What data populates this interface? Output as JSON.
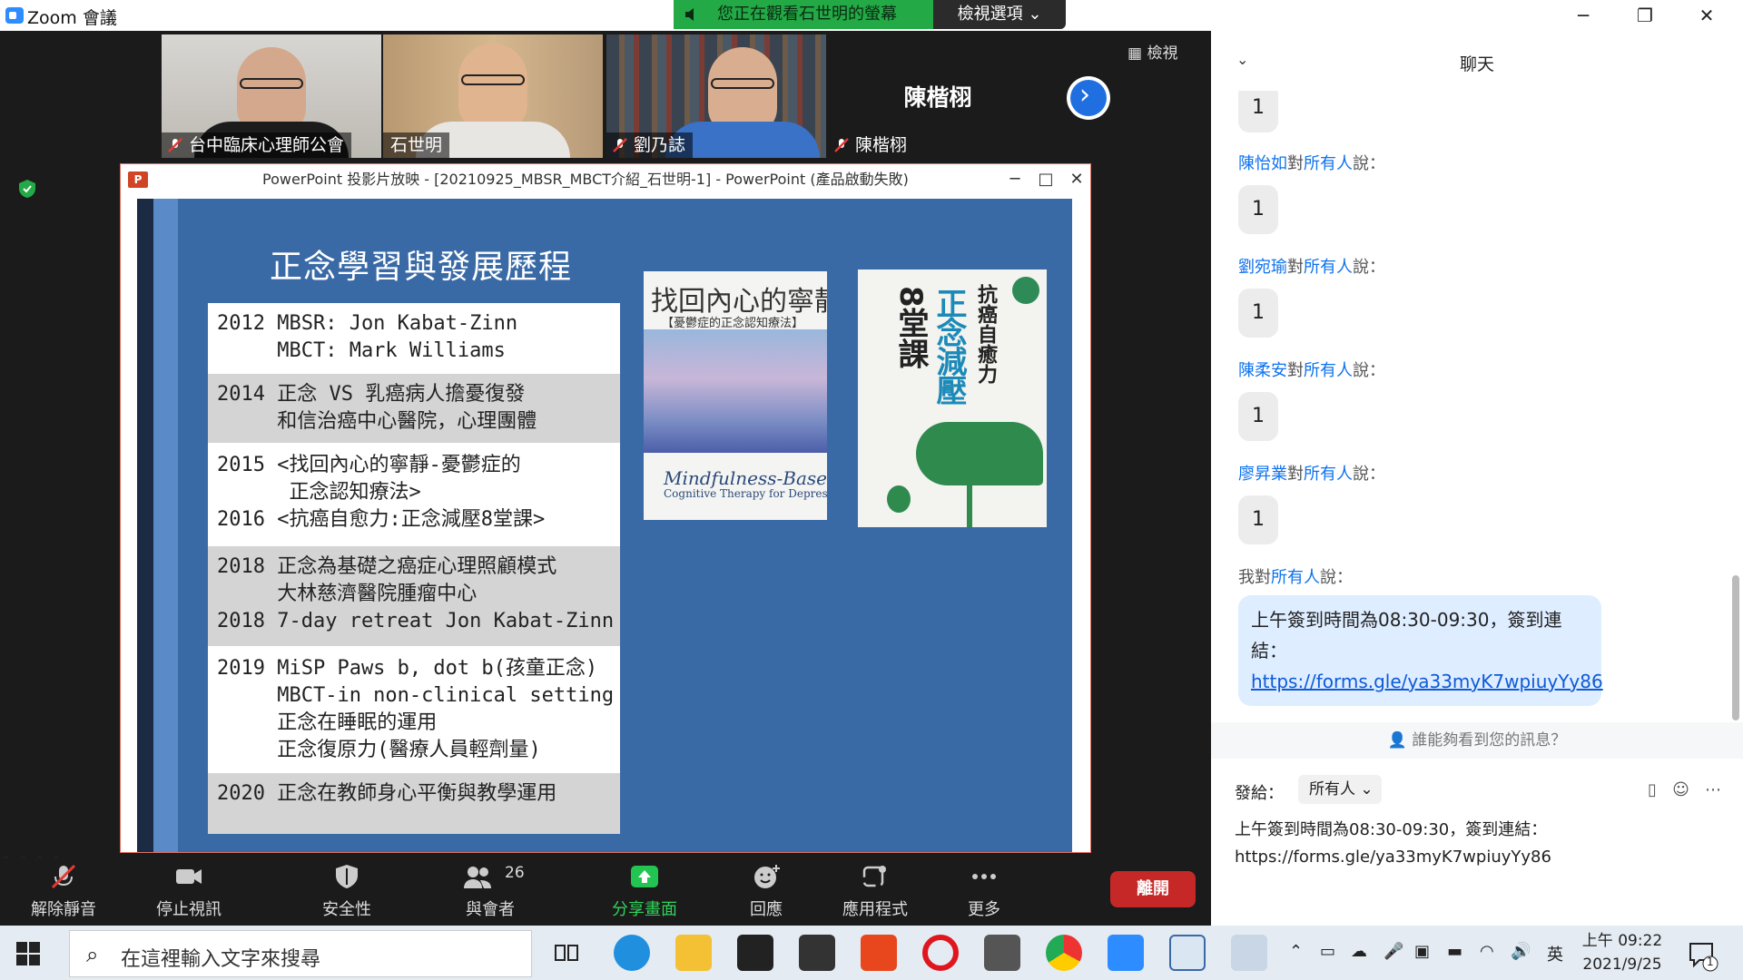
{
  "window": {
    "app_title": "Zoom 會議",
    "viewing_banner": "您正在觀看石世明的螢幕",
    "view_options": "檢視選項 ⌄",
    "minimize_glyph": "─",
    "maximize_glyph": "❐",
    "close_glyph": "✕"
  },
  "gallery": {
    "view_label": "檢視",
    "next_glyph": "›",
    "participants": [
      {
        "name": "台中臨床心理師公會",
        "muted": true
      },
      {
        "name": "石世明",
        "muted": false,
        "active_speaker": true
      },
      {
        "name": "劉乃誌",
        "muted": true
      },
      {
        "name": "陳楷栩",
        "muted": true,
        "video": false
      }
    ],
    "big_name": "陳楷栩"
  },
  "ppt": {
    "title": "PowerPoint 投影片放映 - [20210925_MBSR_MBCT介紹_石世明-1] - PowerPoint (產品啟動失敗)",
    "icon_letter": "P",
    "ctl_min": "─",
    "ctl_max": "□",
    "ctl_close": "✕"
  },
  "slide": {
    "title": "正念學習與發展歷程",
    "rows": [
      "2012 MBSR: Jon Kabat-Zinn\n     MBCT: Mark Williams",
      "2014 正念 VS 乳癌病人擔憂復發\n     和信治癌中心醫院，心理團體",
      "2015 <找回內心的寧靜-憂鬱症的\n      正念認知療法>\n2016 <抗癌自愈力:正念減壓8堂課>",
      "2018 正念為基礎之癌症心理照顧模式\n     大林慈濟醫院腫瘤中心\n2018 7-day retreat Jon Kabat-Zinn",
      "2019 MiSP Paws b, dot b(孩童正念)\n     MBCT-in non-clinical setting\n     正念在睡眠的運用\n     正念復原力(醫療人員輕劑量)",
      "2020 正念在教師身心平衡與教學運用"
    ],
    "book1": {
      "title": "找回內心的寧靜",
      "subtitle": "【憂鬱症的正念認知療法】",
      "english": "Mindfulness-Based",
      "english2": "Cognitive Therapy for Depression"
    },
    "book2": {
      "line1": "抗癌自癒力",
      "line2": "正念減壓",
      "line3": "8堂課"
    }
  },
  "toolbar": {
    "unmute": "解除靜音",
    "stop_video": "停止視訊",
    "security": "安全性",
    "participants": "與會者",
    "participant_count": "26",
    "share": "分享畫面",
    "reactions": "回應",
    "apps": "應用程式",
    "more": "更多",
    "leave": "離開",
    "caret": "⌃"
  },
  "chat": {
    "title": "聊天",
    "collapse_glyph": "⌄",
    "to_word": "對",
    "everyone": "所有人",
    "says": "說：",
    "first_bubble": "1",
    "messages": [
      {
        "sender": "陳怡如",
        "text": "1"
      },
      {
        "sender": "劉宛瑜",
        "text": "1"
      },
      {
        "sender": "陳柔安",
        "text": "1"
      },
      {
        "sender": "廖昇業",
        "text": "1"
      }
    ],
    "me": "我",
    "my_message": "上午簽到時間為08:30-09:30，簽到連結：",
    "my_link": "https://forms.gle/ya33myK7wpiuyYy86",
    "who_can_see": "誰能夠看到您的訊息？",
    "send_to_label": "發給：",
    "send_to_value": "所有人",
    "composer_text": "上午簽到時間為08:30-09:30，簽到連結：\nhttps://forms.gle/ya33myK7wpiuyYy86"
  },
  "taskbar": {
    "search_placeholder": "在這裡輸入文字來搜尋",
    "ime": "英",
    "time": "上午 09:22",
    "date": "2021/9/25",
    "notifications": "1"
  }
}
